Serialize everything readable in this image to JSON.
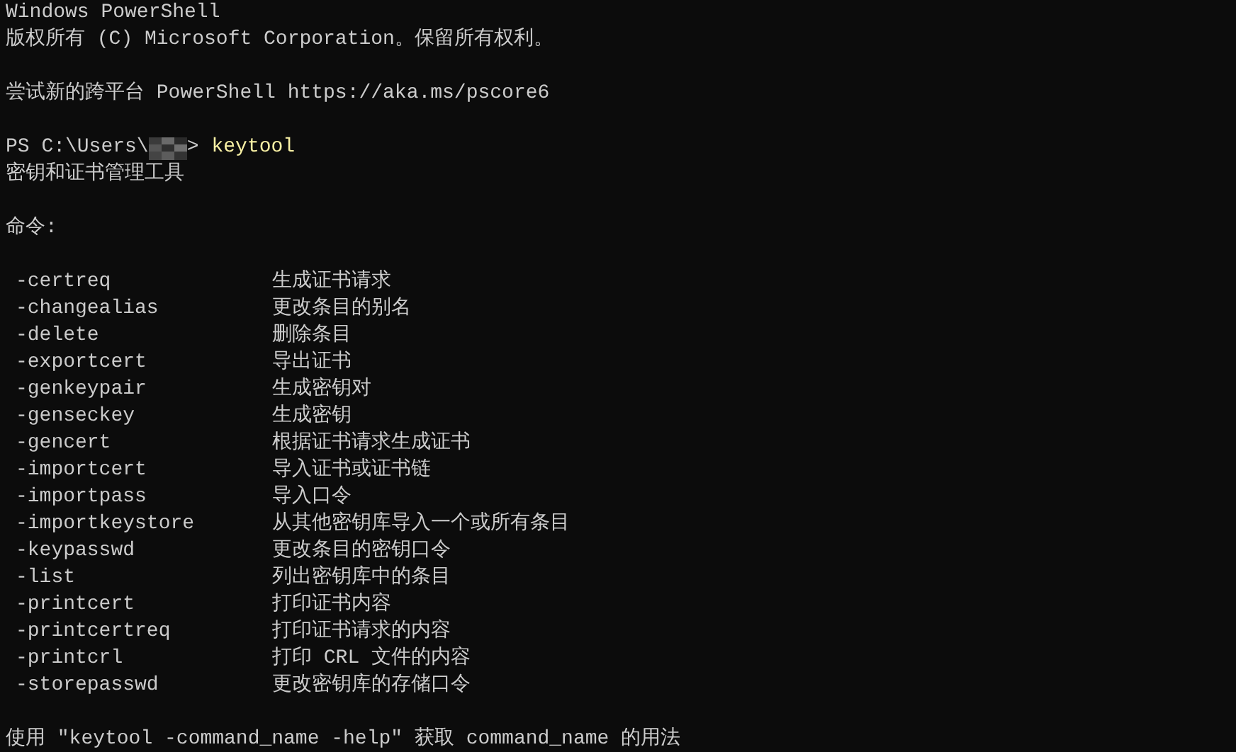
{
  "terminal": {
    "lines": [
      {
        "kind": "text",
        "text": "Windows PowerShell"
      },
      {
        "kind": "text",
        "text": "版权所有 (C) Microsoft Corporation。保留所有权利。"
      },
      {
        "kind": "blank"
      },
      {
        "kind": "text",
        "text": "尝试新的跨平台 PowerShell https://aka.ms/pscore6"
      },
      {
        "kind": "blank"
      },
      {
        "kind": "prompt",
        "prefix": "PS C:\\Users\\",
        "suffix": ">",
        "command": "keytool"
      },
      {
        "kind": "text",
        "text": "密钥和证书管理工具"
      },
      {
        "kind": "blank"
      },
      {
        "kind": "text",
        "text": "命令:"
      },
      {
        "kind": "blank"
      },
      {
        "kind": "option",
        "option": "-certreq",
        "description": "生成证书请求"
      },
      {
        "kind": "option",
        "option": "-changealias",
        "description": "更改条目的别名"
      },
      {
        "kind": "option",
        "option": "-delete",
        "description": "删除条目"
      },
      {
        "kind": "option",
        "option": "-exportcert",
        "description": "导出证书"
      },
      {
        "kind": "option",
        "option": "-genkeypair",
        "description": "生成密钥对"
      },
      {
        "kind": "option",
        "option": "-genseckey",
        "description": "生成密钥"
      },
      {
        "kind": "option",
        "option": "-gencert",
        "description": "根据证书请求生成证书"
      },
      {
        "kind": "option",
        "option": "-importcert",
        "description": "导入证书或证书链"
      },
      {
        "kind": "option",
        "option": "-importpass",
        "description": "导入口令"
      },
      {
        "kind": "option",
        "option": "-importkeystore",
        "description": "从其他密钥库导入一个或所有条目"
      },
      {
        "kind": "option",
        "option": "-keypasswd",
        "description": "更改条目的密钥口令"
      },
      {
        "kind": "option",
        "option": "-list",
        "description": "列出密钥库中的条目"
      },
      {
        "kind": "option",
        "option": "-printcert",
        "description": "打印证书内容"
      },
      {
        "kind": "option",
        "option": "-printcertreq",
        "description": "打印证书请求的内容"
      },
      {
        "kind": "option",
        "option": "-printcrl",
        "description": "打印 CRL 文件的内容"
      },
      {
        "kind": "option",
        "option": "-storepasswd",
        "description": "更改密钥库的存储口令"
      },
      {
        "kind": "blank"
      },
      {
        "kind": "text",
        "text": "使用 \"keytool -command_name -help\" 获取 command_name 的用法"
      }
    ]
  }
}
